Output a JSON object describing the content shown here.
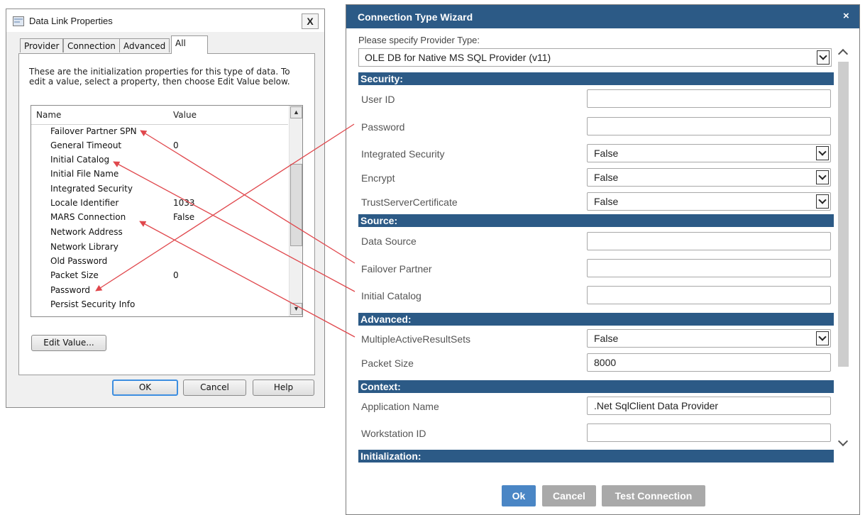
{
  "data_link": {
    "title": "Data Link Properties",
    "close_label": "X",
    "tabs": [
      "Provider",
      "Connection",
      "Advanced",
      "All"
    ],
    "description": "These are the initialization properties for this type of data. To edit a value, select a property, then choose Edit Value below.",
    "columns": {
      "name": "Name",
      "value": "Value"
    },
    "rows": [
      {
        "name": "Failover Partner SPN",
        "value": ""
      },
      {
        "name": "General Timeout",
        "value": "0"
      },
      {
        "name": "Initial Catalog",
        "value": ""
      },
      {
        "name": "Initial File Name",
        "value": ""
      },
      {
        "name": "Integrated Security",
        "value": ""
      },
      {
        "name": "Locale Identifier",
        "value": "1033"
      },
      {
        "name": "MARS Connection",
        "value": "False"
      },
      {
        "name": "Network Address",
        "value": ""
      },
      {
        "name": "Network Library",
        "value": ""
      },
      {
        "name": "Old Password",
        "value": ""
      },
      {
        "name": "Packet Size",
        "value": "0"
      },
      {
        "name": "Password",
        "value": ""
      },
      {
        "name": "Persist Security Info",
        "value": ""
      }
    ],
    "edit_value_label": "Edit Value...",
    "ok_label": "OK",
    "cancel_label": "Cancel",
    "help_label": "Help"
  },
  "wizard": {
    "title": "Connection Type Wizard",
    "close_label": "×",
    "provider_prompt": "Please specify Provider Type:",
    "provider_value": "OLE DB for Native MS SQL Provider (v11)",
    "sections": {
      "security": "Security:",
      "source": "Source:",
      "advanced": "Advanced:",
      "context": "Context:",
      "initialization": "Initialization:"
    },
    "fields": {
      "user_id": {
        "label": "User ID",
        "value": ""
      },
      "password": {
        "label": "Password",
        "value": ""
      },
      "integrated_security": {
        "label": "Integrated Security",
        "value": "False"
      },
      "encrypt": {
        "label": "Encrypt",
        "value": "False"
      },
      "trust_server_certificate": {
        "label": "TrustServerCertificate",
        "value": "False"
      },
      "data_source": {
        "label": "Data Source",
        "value": ""
      },
      "failover_partner": {
        "label": "Failover Partner",
        "value": ""
      },
      "initial_catalog": {
        "label": "Initial Catalog",
        "value": ""
      },
      "multiple_active_result_sets": {
        "label": "MultipleActiveResultSets",
        "value": "False"
      },
      "packet_size": {
        "label": "Packet Size",
        "value": "8000"
      },
      "application_name": {
        "label": "Application Name",
        "value": ".Net SqlClient Data Provider"
      },
      "workstation_id": {
        "label": "Workstation ID",
        "value": ""
      }
    },
    "buttons": {
      "ok": "Ok",
      "cancel": "Cancel",
      "test_connection": "Test Connection"
    }
  },
  "colors": {
    "wizard_header": "#2c5a86",
    "button_primary": "#4a86c5",
    "button_disabled": "#a9a9a9",
    "annotation_arrow": "#e0474c"
  },
  "icons": {
    "data_link_title_icon": "window-properties-icon",
    "scroll_up": "triangle-up-icon",
    "scroll_down": "triangle-down-icon",
    "select_chevron": "chevron-down-icon"
  }
}
